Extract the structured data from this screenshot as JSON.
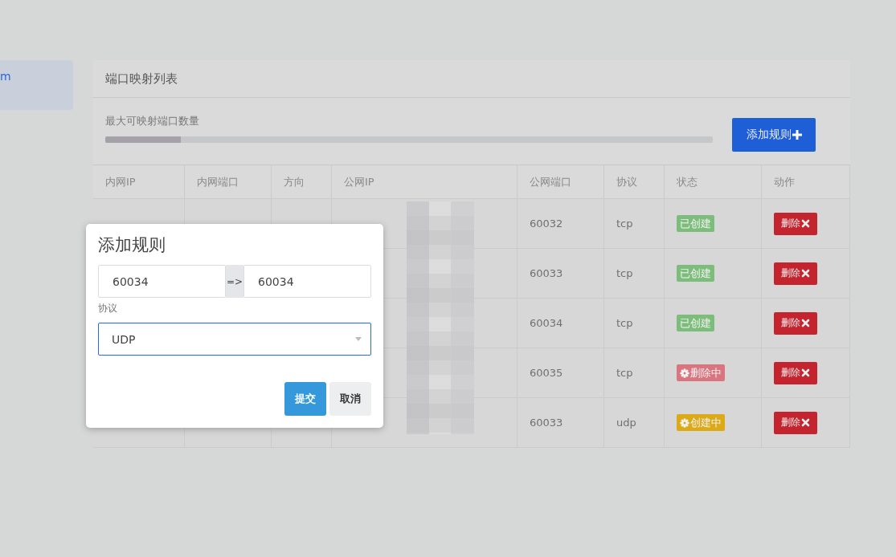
{
  "sidebar": {
    "items": [
      {
        "label": "m",
        "selected": true
      }
    ]
  },
  "card": {
    "title": "端口映射列表",
    "quota": {
      "label": "最大可映射端口数量",
      "level": 0.124
    },
    "add_button": "添加规则"
  },
  "table": {
    "columns": [
      "内网IP",
      "内网端口",
      "方向",
      "公网IP",
      "公网端口",
      "协议",
      "状态",
      "动作"
    ],
    "rows": [
      {
        "public_port": "60032",
        "protocol": "tcp",
        "status": {
          "kind": "created",
          "label": "已创建"
        },
        "action": "删除"
      },
      {
        "public_port": "60033",
        "protocol": "tcp",
        "status": {
          "kind": "created",
          "label": "已创建"
        },
        "action": "删除"
      },
      {
        "public_port": "60034",
        "protocol": "tcp",
        "status": {
          "kind": "created",
          "label": "已创建"
        },
        "action": "删除"
      },
      {
        "public_port": "60035",
        "protocol": "tcp",
        "status": {
          "kind": "deleting",
          "label": "删除中"
        },
        "action": "删除"
      },
      {
        "public_port": "60033",
        "protocol": "udp",
        "status": {
          "kind": "creating",
          "label": "创建中"
        },
        "action": "删除"
      }
    ]
  },
  "dialog": {
    "title": "添加规则",
    "internal_port": "60034",
    "arrow": "=>",
    "public_port": "60034",
    "protocol_label": "协议",
    "protocol": "UDP",
    "buttons": [
      {
        "kind": "primary",
        "label": "提交"
      },
      {
        "kind": "default",
        "label": "取消"
      }
    ]
  }
}
